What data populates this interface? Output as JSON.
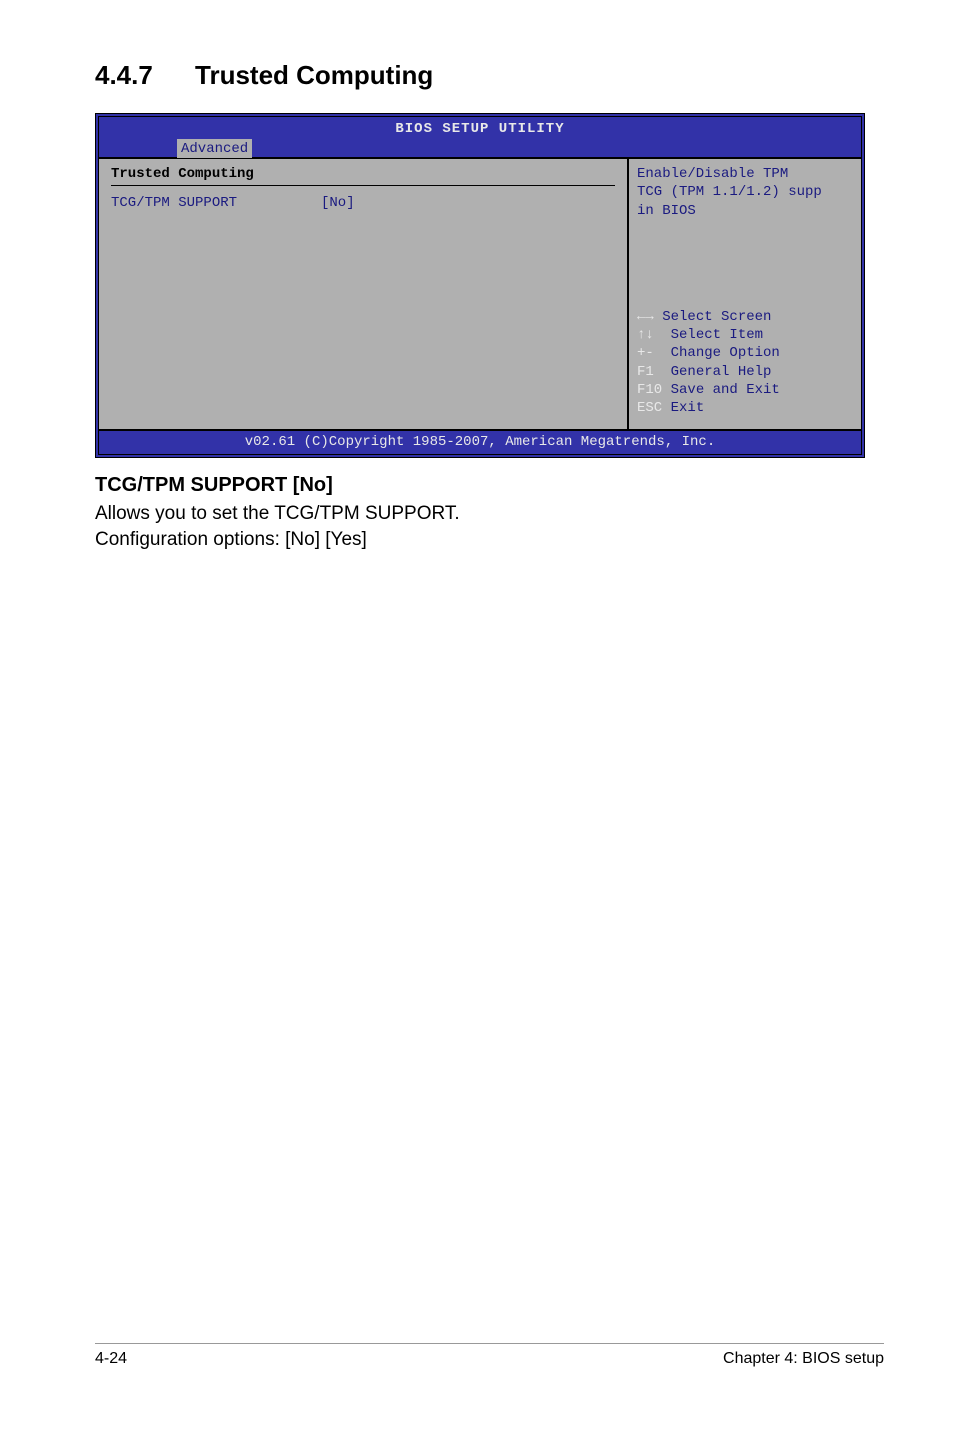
{
  "heading": {
    "number": "4.4.7",
    "title": "Trusted Computing"
  },
  "bios": {
    "header": "BIOS SETUP UTILITY",
    "tab": "Advanced",
    "panel_title": "Trusted Computing",
    "option": {
      "label": "TCG/TPM SUPPORT",
      "value": "[No]"
    },
    "help": {
      "line1": "Enable/Disable TPM",
      "line2": "TCG (TPM 1.1/1.2) supp",
      "line3": "in BIOS"
    },
    "keys": {
      "k1_sym": "←→",
      "k1_txt": " Select Screen",
      "k2_sym": "↑↓",
      "k2_txt": "  Select Item",
      "k3_sym": "+-",
      "k3_txt": "  Change Option",
      "k4_sym": "F1",
      "k4_txt": "  General Help",
      "k5_sym": "F10",
      "k5_txt": " Save and Exit",
      "k6_sym": "ESC",
      "k6_txt": " Exit"
    },
    "footer": "v02.61 (C)Copyright 1985-2007, American Megatrends, Inc."
  },
  "sub": {
    "heading": "TCG/TPM SUPPORT [No]",
    "line1": "Allows you to set the TCG/TPM SUPPORT.",
    "line2": "Configuration options: [No] [Yes]"
  },
  "footer": {
    "left": "4-24",
    "right": "Chapter 4: BIOS setup"
  }
}
